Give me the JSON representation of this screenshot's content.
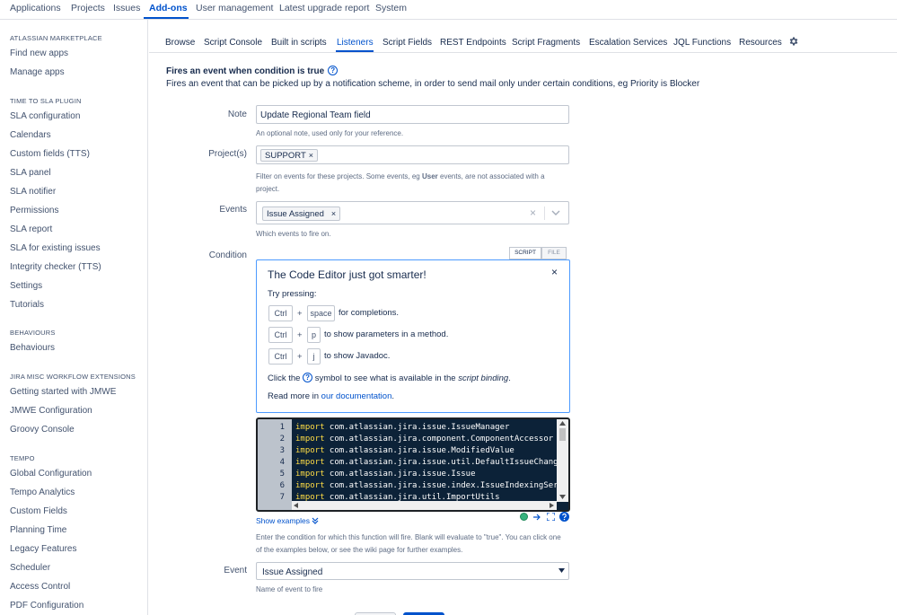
{
  "topnav": {
    "items": [
      "Applications",
      "Projects",
      "Issues",
      "Add-ons",
      "User management",
      "Latest upgrade report",
      "System"
    ],
    "active": "Add-ons"
  },
  "sidebar": {
    "sections": [
      {
        "title": "ATLASSIAN MARKETPLACE",
        "items": [
          "Find new apps",
          "Manage apps"
        ]
      },
      {
        "title": "TIME TO SLA PLUGIN",
        "items": [
          "SLA configuration",
          "Calendars",
          "Custom fields (TTS)",
          "SLA panel",
          "SLA notifier",
          "Permissions",
          "SLA report",
          "SLA for existing issues",
          "Integrity checker (TTS)",
          "Settings",
          "Tutorials"
        ]
      },
      {
        "title": "BEHAVIOURS",
        "items": [
          "Behaviours"
        ]
      },
      {
        "title": "JIRA MISC WORKFLOW EXTENSIONS",
        "items": [
          "Getting started with JMWE",
          "JMWE Configuration",
          "Groovy Console"
        ]
      },
      {
        "title": "TEMPO",
        "items": [
          "Global Configuration",
          "Tempo Analytics",
          "Custom Fields",
          "Planning Time",
          "Legacy Features",
          "Scheduler",
          "Access Control",
          "PDF Configuration"
        ]
      }
    ]
  },
  "subnav": {
    "items": [
      "Browse",
      "Script Console",
      "Built in scripts",
      "Listeners",
      "Script Fields",
      "REST Endpoints",
      "Script Fragments",
      "Escalation Services",
      "JQL Functions",
      "Resources"
    ],
    "active": "Listeners",
    "settings_icon": "gear-icon"
  },
  "form": {
    "heading": "Fires an event when condition is true",
    "heading_help": "?",
    "description": "Fires an event that can be picked up by a notification scheme, in order to send mail only under certain conditions, eg Priority is Blocker",
    "note": {
      "label": "Note",
      "value": "Update Regional Team field",
      "help": "An optional note, used only for your reference."
    },
    "projects": {
      "label": "Project(s)",
      "tag": "SUPPORT",
      "tag_remove": "×",
      "help_pre": "Filter on events for these projects. Some events, eg ",
      "help_bold": "User",
      "help_post": " events, are not associated with a project."
    },
    "events": {
      "label": "Events",
      "tag": "Issue Assigned",
      "tag_remove": "×",
      "clear": "×",
      "help": "Which events to fire on."
    },
    "condition": {
      "label": "Condition",
      "toggle_script": "SCRIPT",
      "toggle_file": "FILE",
      "popup": {
        "title": "The Code Editor just got smarter!",
        "close": "×",
        "try": "Try pressing:",
        "plus": "+",
        "row1": {
          "key1": "Ctrl",
          "key2": "space",
          "text": "for completions."
        },
        "row2": {
          "key1": "Ctrl",
          "key2": "p",
          "text": "to show parameters in a method."
        },
        "row3": {
          "key1": "Ctrl",
          "key2": "j",
          "text": "to show Javadoc."
        },
        "click_pre": "Click the",
        "click_icon": "?",
        "click_mid": "symbol to see what is available in the",
        "click_em": "script binding",
        "click_end": ".",
        "read_pre": "Read more in ",
        "read_link": "our documentation",
        "read_end": "."
      },
      "code_lines": [
        {
          "n": "1",
          "kw": "import",
          "rest": " com.atlassian.jira.issue.IssueManager"
        },
        {
          "n": "2",
          "kw": "import",
          "rest": " com.atlassian.jira.component.ComponentAccessor"
        },
        {
          "n": "3",
          "kw": "import",
          "rest": " com.atlassian.jira.issue.ModifiedValue"
        },
        {
          "n": "4",
          "kw": "import",
          "rest": " com.atlassian.jira.issue.util.DefaultIssueChangeHolder"
        },
        {
          "n": "5",
          "kw": "import",
          "rest": " com.atlassian.jira.issue.Issue"
        },
        {
          "n": "6",
          "kw": "import",
          "rest": " com.atlassian.jira.issue.index.IssueIndexingService"
        },
        {
          "n": "7",
          "kw": "import",
          "rest": " com.atlassian.jira.util.ImportUtils"
        }
      ],
      "show_examples": "Show examples",
      "show_examples_icon": "chevron-double-down-icon",
      "help": "Enter the condition for which this function will fire. Blank will evaluate to \"true\". You can click one of the examples below, or see the wiki page for further examples."
    },
    "event": {
      "label": "Event",
      "value": "Issue Assigned",
      "help": "Name of event to fire"
    }
  },
  "colors": {
    "accent": "#0052cc",
    "editor_bg": "#0c2238",
    "keyword": "#ffdd44",
    "status_ok": "#36b37e"
  }
}
